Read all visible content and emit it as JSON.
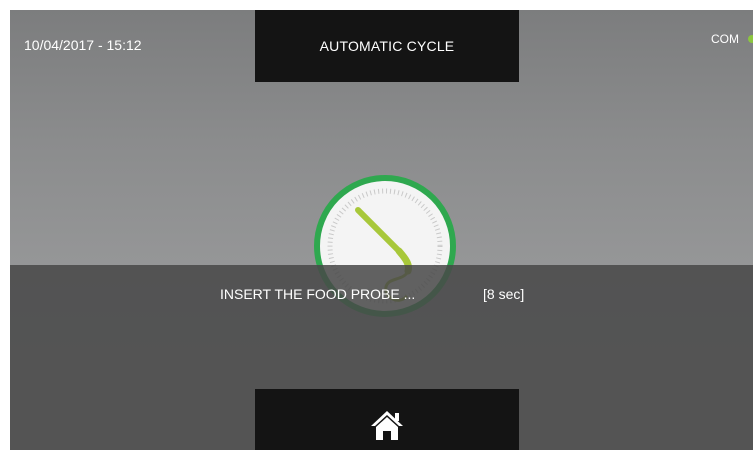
{
  "status_bar": {
    "datetime": "10/04/2017 - 15:12",
    "com_label": "COM",
    "com_status_color": "#8cc63f"
  },
  "header": {
    "title": "AUTOMATIC CYCLE"
  },
  "dialog": {
    "message": "INSERT THE FOOD PROBE ...",
    "countdown": "[8 sec]"
  },
  "illustration": {
    "icon": "food-probe-icon",
    "accent_color": "#2fa84f",
    "probe_color": "#a8c83a"
  },
  "footer": {
    "home_icon": "home-icon"
  }
}
